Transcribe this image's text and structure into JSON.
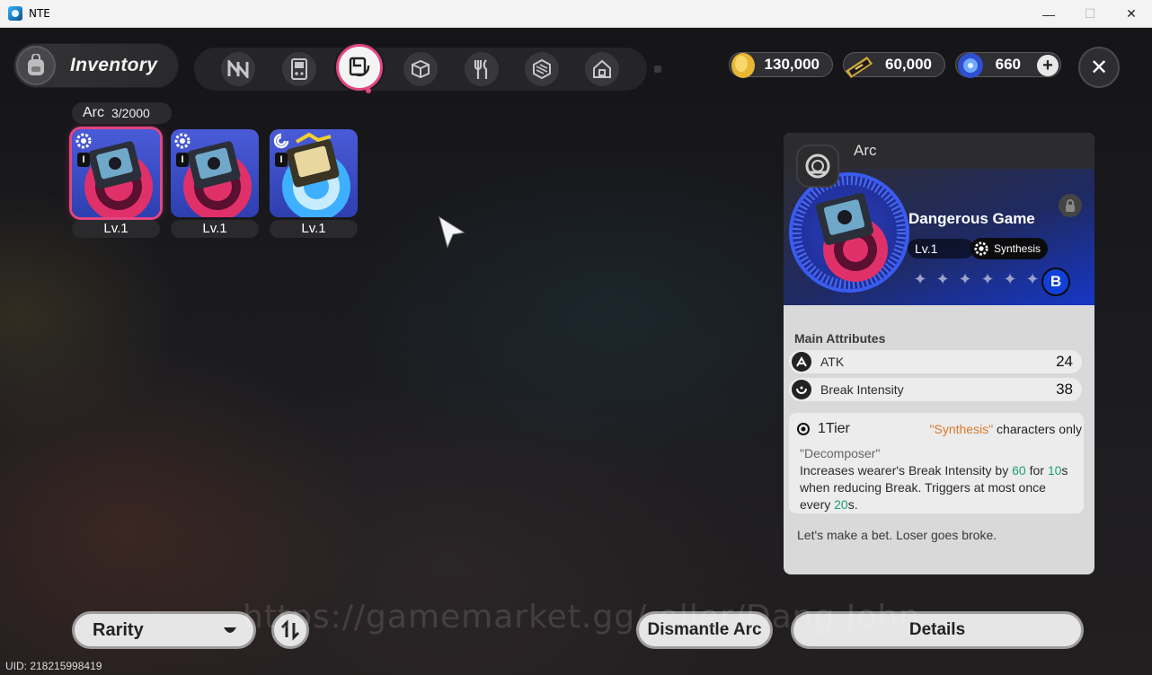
{
  "window": {
    "title": "NTE",
    "minimize": "—",
    "maximize": "☐",
    "close": "✕"
  },
  "header": {
    "inventory_label": "Inventory",
    "tabs": [
      {
        "name": "tab-n",
        "icon": "n-logo-icon"
      },
      {
        "name": "tab-device",
        "icon": "gameboy-icon"
      },
      {
        "name": "tab-arc",
        "icon": "arc-icon",
        "active": true
      },
      {
        "name": "tab-box",
        "icon": "box-icon"
      },
      {
        "name": "tab-food",
        "icon": "fork-knife-icon"
      },
      {
        "name": "tab-material",
        "icon": "cube-pattern-icon"
      },
      {
        "name": "tab-home",
        "icon": "house-icon"
      }
    ],
    "currencies": [
      {
        "icon": "gold-coin-icon",
        "value": "130,000"
      },
      {
        "icon": "ticket-icon",
        "value": "60,000"
      },
      {
        "icon": "crystal-icon",
        "value": "660"
      }
    ],
    "plus_label": "+",
    "close_label": "✕"
  },
  "grid": {
    "category_label": "Arc",
    "count": "3/2000",
    "items": [
      {
        "roman": "I",
        "level": "Lv.1",
        "selected": true
      },
      {
        "roman": "I",
        "level": "Lv.1",
        "selected": false
      },
      {
        "roman": "I",
        "level": "Lv.1",
        "selected": false
      }
    ]
  },
  "detail": {
    "header": "Arc",
    "name": "Dangerous Game",
    "level": "Lv.1",
    "tag": "Synthesis",
    "stars": [
      "✦",
      "✦",
      "✦",
      "✦",
      "✦",
      "✦"
    ],
    "rank_badge": "B",
    "main_attributes_title": "Main Attributes",
    "attributes": [
      {
        "name": "ATK",
        "value": "24",
        "icon": "atk-icon"
      },
      {
        "name": "Break Intensity",
        "value": "38",
        "icon": "break-icon"
      }
    ],
    "tier": {
      "name": "1Tier",
      "cond_q": "\"Synthesis\"",
      "cond_rest": " characters only",
      "skill_name": "\"Decomposer\"",
      "desc_1": "Increases wearer's Break Intensity by ",
      "val_1": "60",
      "desc_2": " for ",
      "val_2": "10",
      "desc_3": "s when reducing Break. Triggers at most once every ",
      "val_3": "20",
      "desc_4": "s."
    },
    "flavor": "Let's make a bet. Loser goes broke."
  },
  "footer": {
    "sort_label": "Rarity",
    "dismantle_label": "Dismantle Arc",
    "details_label": "Details",
    "watermark": "https://gamemarket.gg/  eller/Dang John",
    "uid": "UID: 218215998419"
  },
  "colors": {
    "accent_pink": "#e24682",
    "rarity_blue": "#2e3fb0",
    "highlight_orange": "#d9782b",
    "highlight_green": "#1aa078"
  }
}
